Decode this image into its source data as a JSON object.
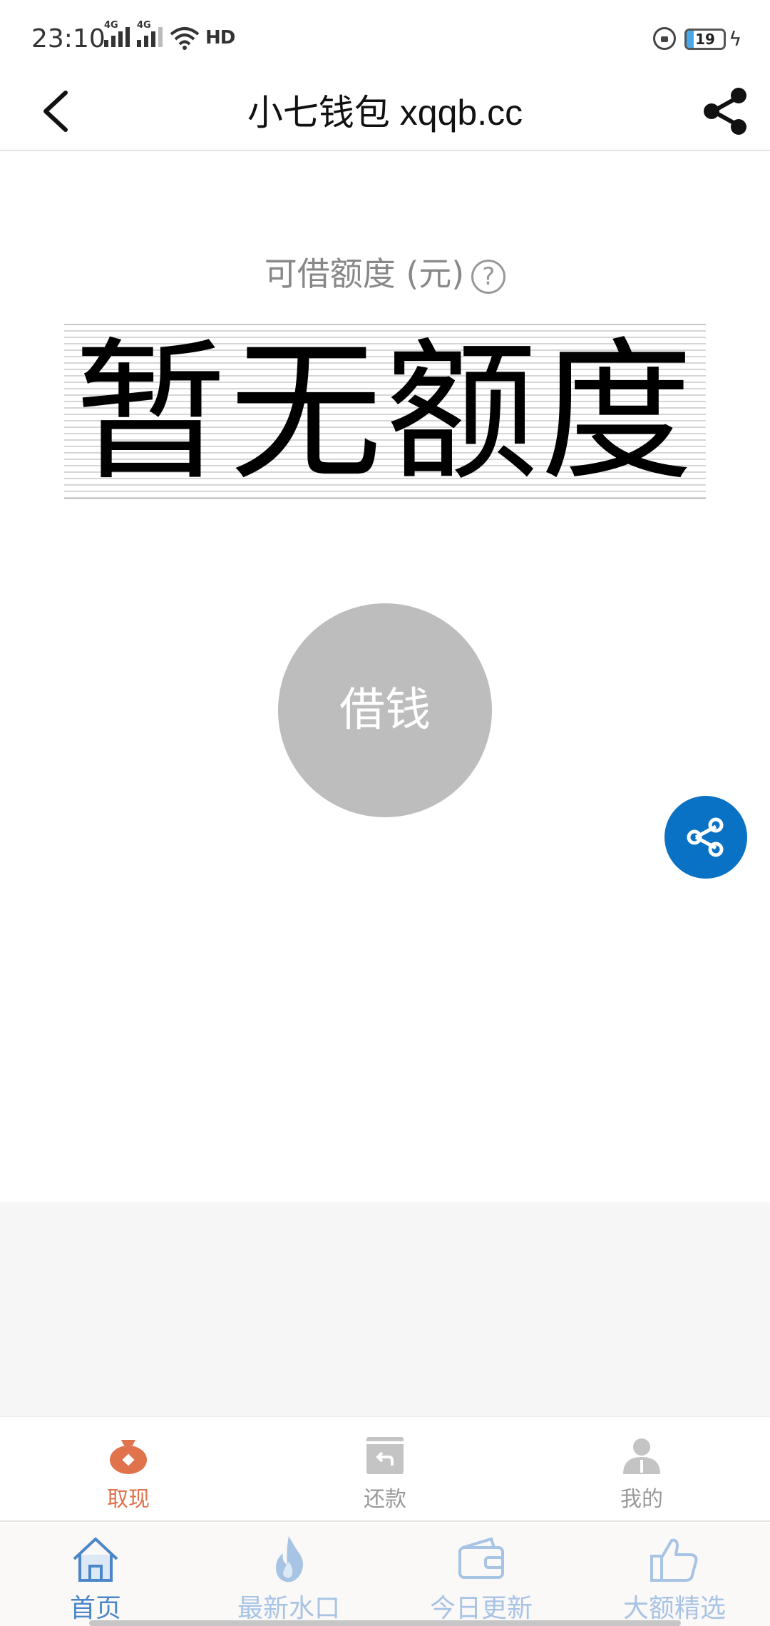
{
  "status_bar": {
    "time": "23:10",
    "network_1": "4G",
    "network_2": "4G",
    "hd_label": "HD",
    "battery_level": "19",
    "icons": [
      "signal-icon",
      "wifi-icon",
      "hd-icon",
      "lock-rotation-icon",
      "battery-icon",
      "charging-icon"
    ]
  },
  "header": {
    "title": "小七钱包 xqqb.cc",
    "back_icon": "chevron-left-icon",
    "share_icon": "share-icon"
  },
  "main": {
    "credit_label": "可借额度 (元)",
    "help_glyph": "?",
    "credit_amount": "暂无额度",
    "borrow_button": "借钱",
    "float_share_icon": "share-icon"
  },
  "inner_tabs": [
    {
      "label": "取现",
      "icon": "money-bag-icon",
      "active": true
    },
    {
      "label": "还款",
      "icon": "repay-icon",
      "active": false
    },
    {
      "label": "我的",
      "icon": "user-icon",
      "active": false
    }
  ],
  "outer_tabs": [
    {
      "label": "首页",
      "icon": "home-icon",
      "active": true
    },
    {
      "label": "最新水口",
      "icon": "flame-icon",
      "active": false
    },
    {
      "label": "今日更新",
      "icon": "wallet-icon",
      "active": false
    },
    {
      "label": "大额精选",
      "icon": "thumbs-up-icon",
      "active": false
    }
  ],
  "colors": {
    "accent_orange": "#e0724c",
    "share_blue": "#0a72c4",
    "tab_blue_active": "#4a86c8",
    "tab_blue_inactive": "#a7c4e4",
    "borrow_grey": "#bdbdbd"
  }
}
